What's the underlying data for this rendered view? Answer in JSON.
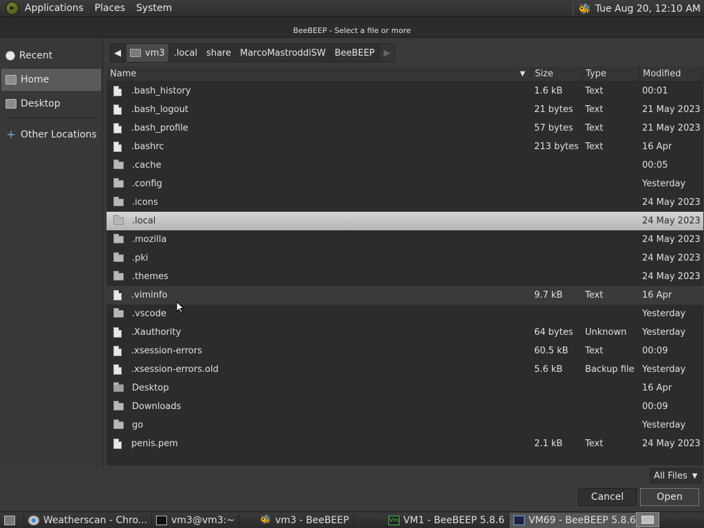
{
  "top_panel": {
    "menus": [
      "Applications",
      "Places",
      "System"
    ],
    "clock": "Tue Aug 20, 12:10 AM"
  },
  "dialog": {
    "title": "BeeBEEP - Select a file or more"
  },
  "sidebar": {
    "items": [
      {
        "label": "Recent",
        "icon": "clock-icon"
      },
      {
        "label": "Home",
        "icon": "home-folder-icon",
        "active": true
      },
      {
        "label": "Desktop",
        "icon": "desktop-folder-icon"
      },
      {
        "label": "Other Locations",
        "icon": "plus-icon"
      }
    ]
  },
  "breadcrumb": {
    "items": [
      "vm3",
      ".local",
      "share",
      "MarcoMastroddiSW",
      "BeeBEEP"
    ]
  },
  "columns": {
    "name": "Name",
    "size": "Size",
    "type": "Type",
    "modified": "Modified"
  },
  "files": [
    {
      "name": ".bash_history",
      "kind": "file",
      "size": "1.6 kB",
      "type": "Text",
      "modified": "00:01"
    },
    {
      "name": ".bash_logout",
      "kind": "file",
      "size": "21 bytes",
      "type": "Text",
      "modified": "21 May 2023"
    },
    {
      "name": ".bash_profile",
      "kind": "file",
      "size": "57 bytes",
      "type": "Text",
      "modified": "21 May 2023"
    },
    {
      "name": ".bashrc",
      "kind": "file",
      "size": "213 bytes",
      "type": "Text",
      "modified": "16 Apr"
    },
    {
      "name": ".cache",
      "kind": "folder",
      "size": "",
      "type": "",
      "modified": "00:05"
    },
    {
      "name": ".config",
      "kind": "folder",
      "size": "",
      "type": "",
      "modified": "Yesterday"
    },
    {
      "name": ".icons",
      "kind": "folder",
      "size": "",
      "type": "",
      "modified": "24 May 2023"
    },
    {
      "name": ".local",
      "kind": "folder",
      "size": "",
      "type": "",
      "modified": "24 May 2023",
      "selected": true
    },
    {
      "name": ".mozilla",
      "kind": "folder",
      "size": "",
      "type": "",
      "modified": "24 May 2023"
    },
    {
      "name": ".pki",
      "kind": "folder",
      "size": "",
      "type": "",
      "modified": "24 May 2023"
    },
    {
      "name": ".themes",
      "kind": "folder",
      "size": "",
      "type": "",
      "modified": "24 May 2023"
    },
    {
      "name": ".viminfo",
      "kind": "file",
      "size": "9.7 kB",
      "type": "Text",
      "modified": "16 Apr",
      "hover": true
    },
    {
      "name": ".vscode",
      "kind": "folder",
      "size": "",
      "type": "",
      "modified": "Yesterday"
    },
    {
      "name": ".Xauthority",
      "kind": "file",
      "size": "64 bytes",
      "type": "Unknown",
      "modified": "Yesterday"
    },
    {
      "name": ".xsession-errors",
      "kind": "file",
      "size": "60.5 kB",
      "type": "Text",
      "modified": "00:09"
    },
    {
      "name": ".xsession-errors.old",
      "kind": "file",
      "size": "5.6 kB",
      "type": "Backup file",
      "modified": "Yesterday"
    },
    {
      "name": "Desktop",
      "kind": "desktop-folder",
      "size": "",
      "type": "",
      "modified": "16 Apr"
    },
    {
      "name": "Downloads",
      "kind": "folder",
      "size": "",
      "type": "",
      "modified": "00:09"
    },
    {
      "name": "go",
      "kind": "folder",
      "size": "",
      "type": "",
      "modified": "Yesterday"
    },
    {
      "name": "penis.pem",
      "kind": "file",
      "size": "2.1 kB",
      "type": "Text",
      "modified": "24 May 2023"
    }
  ],
  "filter": {
    "value": "All Files"
  },
  "buttons": {
    "cancel": "Cancel",
    "open": "Open"
  },
  "taskbar": {
    "tasks": [
      {
        "label": "Weatherscan - Chro...",
        "icon": "chrome-icon"
      },
      {
        "label": "vm3@vm3:~",
        "icon": "terminal-icon"
      },
      {
        "label": "vm3 - BeeBEEP",
        "icon": "bee-icon"
      },
      {
        "label": "VM1 - BeeBEEP 5.8.6",
        "icon": "vm-icon"
      },
      {
        "label": "VM69 - BeeBEEP 5.8.6",
        "icon": "vm-monitor-icon",
        "active": true
      }
    ]
  }
}
